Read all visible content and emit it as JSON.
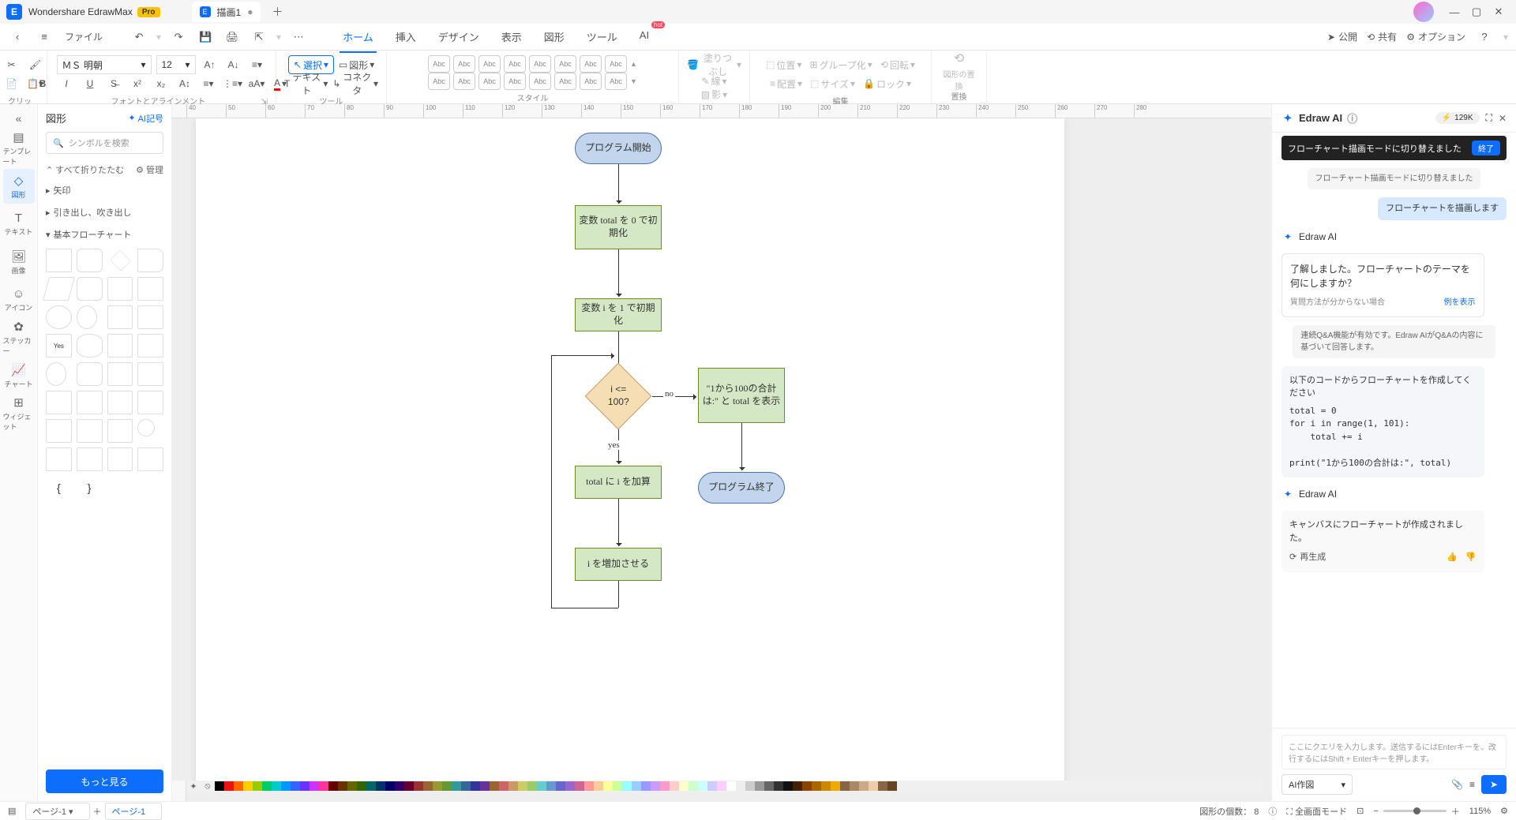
{
  "titlebar": {
    "app_name": "Wondershare EdrawMax",
    "pro": "Pro",
    "tab_title": "描画1",
    "add_tab": "＋"
  },
  "menubar": {
    "file": "ファイル",
    "tabs": [
      "ホーム",
      "挿入",
      "デザイン",
      "表示",
      "図形",
      "ツール",
      "AI"
    ],
    "hot": "hot",
    "right": {
      "publish": "公開",
      "share": "共有",
      "options": "オプション"
    }
  },
  "ribbon": {
    "clipboard": "クリップボード",
    "font_name": "ＭＳ 明朝",
    "font_size": "12",
    "font_align": "フォントとアラインメント",
    "select": "選択",
    "shape": "図形",
    "text": "テキスト",
    "connector": "コネクタ",
    "tool": "ツール",
    "style_item": "Abc",
    "style": "スタイル",
    "fill": "塗りつぶし",
    "line": "線",
    "shadow": "影",
    "position": "位置",
    "arrange_align": "配置",
    "group": "グループ化",
    "size": "サイズ",
    "rotate": "回転",
    "lock": "ロック",
    "arrange": "編集",
    "replace_shape": "図形の置換",
    "replace": "置換"
  },
  "shapes": {
    "title": "図形",
    "ai_symbol": "AI記号",
    "search_ph": "シンボルを検索",
    "collapse_all": "すべて折りたたむ",
    "manage": "管理",
    "sections": {
      "arrows": "矢印",
      "callouts": "引き出し、吹き出し",
      "basic_flow": "基本フローチャート"
    },
    "more": "もっと見る"
  },
  "rail": {
    "template": "テンプレート",
    "shapes": "図形",
    "text": "テキスト",
    "image": "画像",
    "icon": "アイコン",
    "sticker": "ステッカー",
    "chart": "チャート",
    "widget": "ウィジェット"
  },
  "flowchart": {
    "start": "プログラム開始",
    "init_total": "変数 total を 0 で初期化",
    "init_i": "変数 i を 1 で初期化",
    "decision": "i <= 100?",
    "yes": "yes",
    "no": "no",
    "add_total": "total に i を加算",
    "increment_i": "i を増加させる",
    "print": "\"1から100の合計は:\" と total を表示",
    "end": "プログラム終了"
  },
  "ai": {
    "title": "Edraw AI",
    "tokens": "129K",
    "tooltip": "フローチャート描画モードに切り替えました",
    "end": "終了",
    "msg_system1": "フローチャート描画モードに切り替えました",
    "msg_user1": "フローチャートを描画します",
    "msg_ai_name": "Edraw AI",
    "msg_question": "了解しました。フローチャートのテーマを何にしますか？",
    "msg_hint": "質問方法が分からない場合",
    "msg_hint_link": "例を表示",
    "msg_system2": "連続Q&A機能が有効です。Edraw AIがQ&Aの内容に基づいて回答します。",
    "msg_user2_intro": "以下のコードからフローチャートを作成してください",
    "msg_user2_code": "total = 0\nfor i in range(1, 101):\n    total += i\n\nprint(\"1から100の合計は:\", total)",
    "msg_result": "キャンバスにフローチャートが作成されました。",
    "regenerate": "再生成",
    "input_ph": "ここにクエリを入力します。送信するにはEnterキーを、改行するにはShift + Enterキーを押します。",
    "select": "AI作図"
  },
  "status": {
    "page_label": "ページ-1",
    "page_tab": "ページ-1",
    "count_label": "図形の個数：",
    "count_value": "8",
    "fullscreen": "全画面モード",
    "zoom": "115%"
  }
}
